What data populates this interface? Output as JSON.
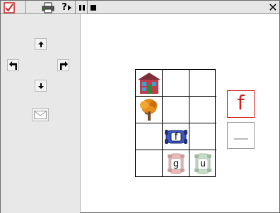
{
  "toolbar": {
    "buttons": [
      {
        "name": "check-icon"
      },
      {
        "name": "printer-icon"
      },
      {
        "name": "help-icon",
        "label": "?"
      },
      {
        "name": "pause-icon"
      },
      {
        "name": "stop-icon"
      }
    ],
    "close_label": "✕"
  },
  "controls": {
    "up": "up-arrow",
    "left": "turn-left-arrow",
    "right": "turn-right-arrow",
    "down": "down-arrow",
    "mail": "envelope-icon"
  },
  "board": {
    "rows": 4,
    "cols": 3,
    "tiles": [
      {
        "type": "house",
        "row": 0,
        "col": 0
      },
      {
        "type": "tree",
        "row": 1,
        "col": 0
      },
      {
        "type": "car",
        "row": 2,
        "col": 1,
        "letter": "f",
        "color": "#3d57c9"
      },
      {
        "type": "car",
        "row": 3,
        "col": 1,
        "letter": "g",
        "color": "#e7b9b9"
      },
      {
        "type": "car",
        "row": 3,
        "col": 2,
        "letter": "u",
        "color": "#c7dcc8"
      }
    ]
  },
  "answer": {
    "letter": "f",
    "accent": "#d41c1c"
  },
  "blank": {
    "symbol": "—"
  }
}
